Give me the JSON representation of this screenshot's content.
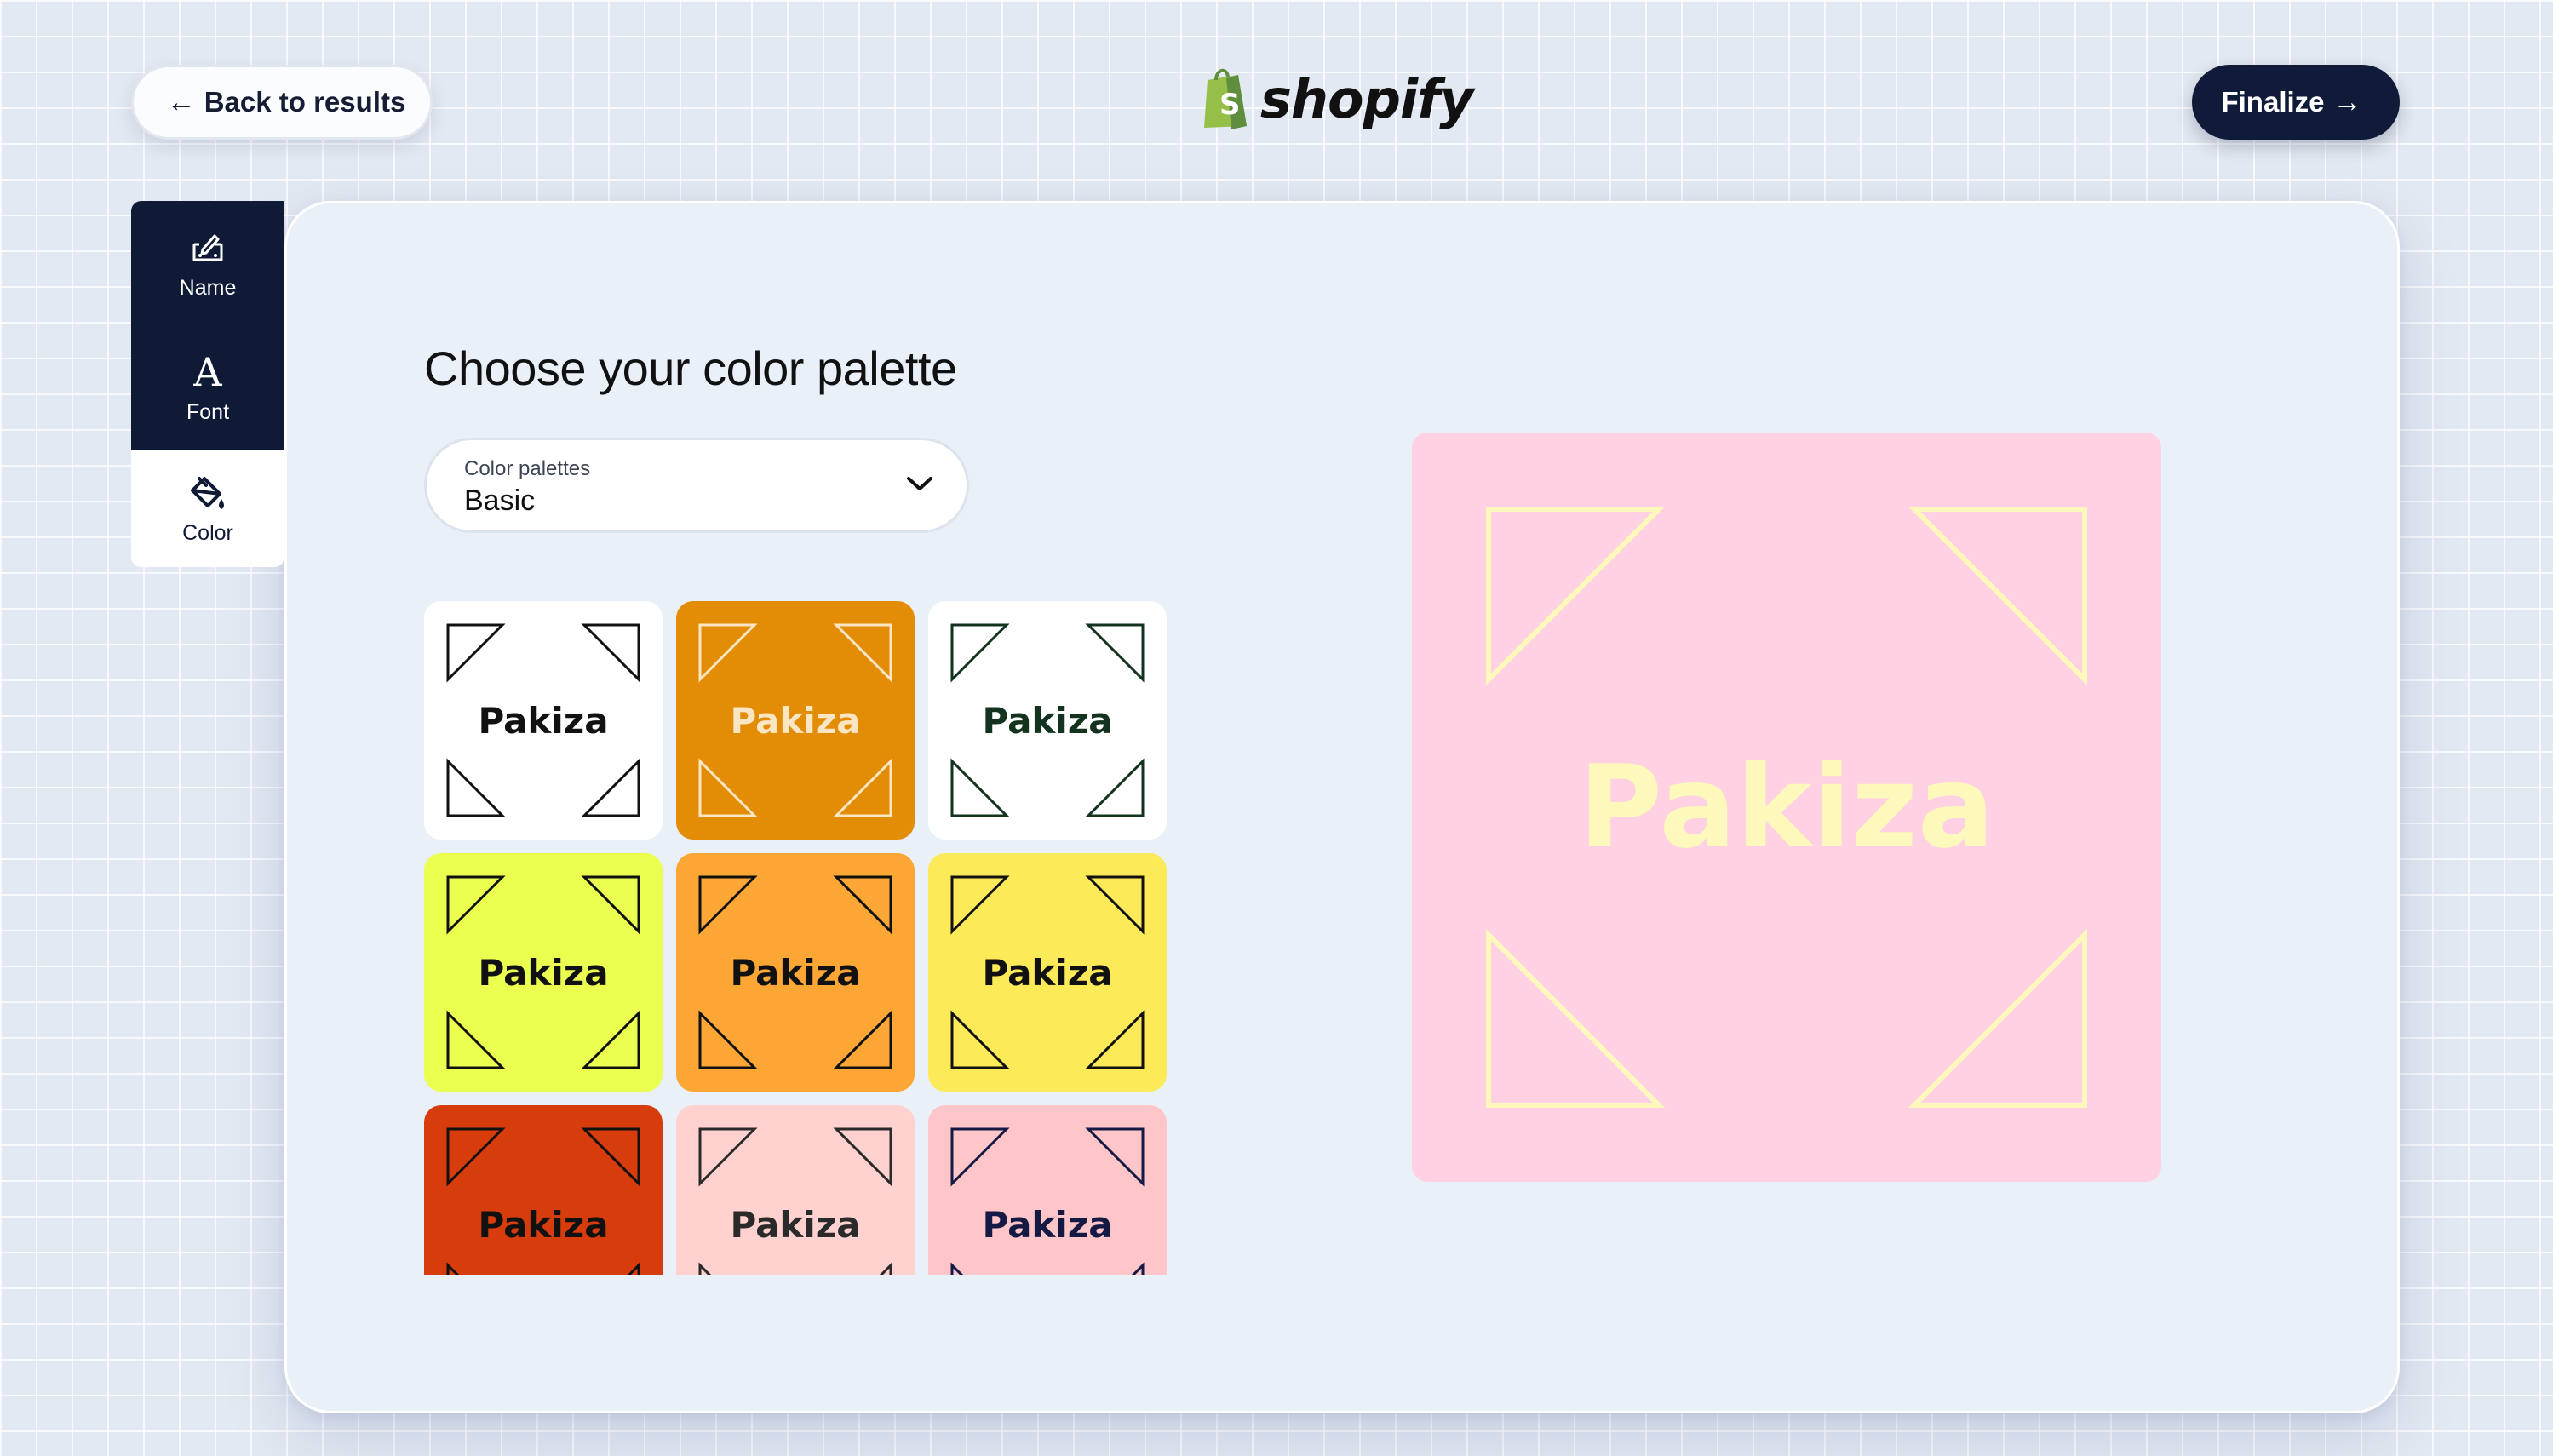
{
  "header": {
    "back_label": "Back to results",
    "logo_text": "shopify",
    "finalize_label": "Finalize"
  },
  "sidebar": {
    "items": [
      {
        "label": "Name",
        "icon": "edit-name-icon",
        "active": false
      },
      {
        "label": "Font",
        "icon": "font-a-icon",
        "active": false
      },
      {
        "label": "Color",
        "icon": "paint-bucket-icon",
        "active": true
      }
    ]
  },
  "main": {
    "title": "Choose your color palette",
    "dropdown": {
      "label": "Color palettes",
      "value": "Basic"
    }
  },
  "swatches": [
    {
      "text": "Pakiza",
      "bg": "#ffffff",
      "fg": "#111111",
      "line": "#111111"
    },
    {
      "text": "Pakiza",
      "bg": "#e38c05",
      "fg": "#fbe6c4",
      "line": "#fbe6c4"
    },
    {
      "text": "Pakiza",
      "bg": "#ffffff",
      "fg": "#14331f",
      "line": "#14331f"
    },
    {
      "text": "Pakiza",
      "bg": "#ebff50",
      "fg": "#111111",
      "line": "#111111"
    },
    {
      "text": "Pakiza",
      "bg": "#fca735",
      "fg": "#111111",
      "line": "#111111"
    },
    {
      "text": "Pakiza",
      "bg": "#fdea58",
      "fg": "#111111",
      "line": "#111111"
    },
    {
      "text": "Pakiza",
      "bg": "#d73d0c",
      "fg": "#111111",
      "line": "#111111"
    },
    {
      "text": "Pakiza",
      "bg": "#ffd1cf",
      "fg": "#2a2a2a",
      "line": "#2a2a2a"
    },
    {
      "text": "Pakiza",
      "bg": "#ffc6c9",
      "fg": "#151a45",
      "line": "#151a45"
    }
  ],
  "preview": {
    "text": "Pakiza",
    "bg": "#ffd1e2",
    "fg": "#fdf8bb",
    "line": "#fdf8bb"
  }
}
